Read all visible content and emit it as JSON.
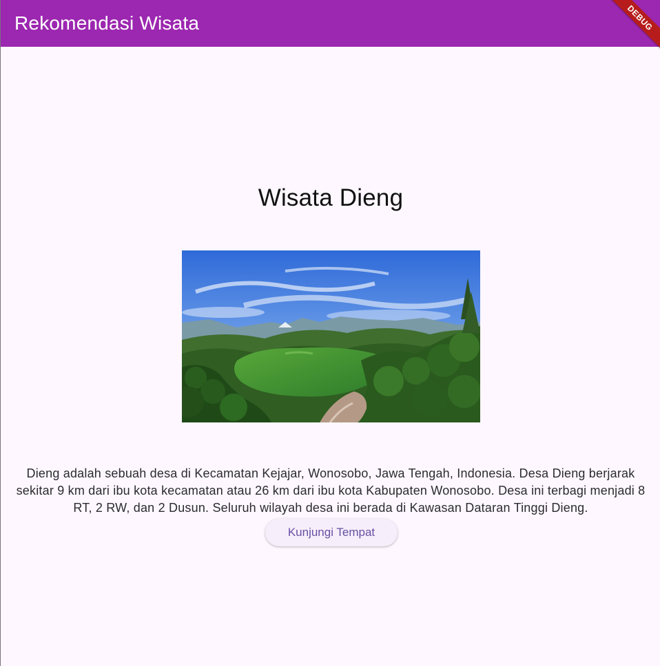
{
  "appbar": {
    "title": "Rekomendasi Wisata",
    "debug_label": "DEBUG"
  },
  "main": {
    "title": "Wisata Dieng",
    "image_subject": "lake-landscape",
    "description": "Dieng adalah sebuah desa di Kecamatan Kejajar, Wonosobo, Jawa Tengah, Indonesia. Desa Dieng berjarak sekitar 9 km dari ibu kota kecamatan atau 26 km dari ibu kota Kabupaten Wonosobo. Desa ini terbagi menjadi 8 RT, 2 RW, dan 2 Dusun. Seluruh wilayah desa ini berada di Kawasan Dataran Tinggi Dieng.",
    "button_label": "Kunjungi Tempat"
  },
  "colors": {
    "appbar": "#9c27b0",
    "background": "#fef7ff",
    "button_text": "#6750a4",
    "debug_ribbon": "#b71c1c"
  }
}
